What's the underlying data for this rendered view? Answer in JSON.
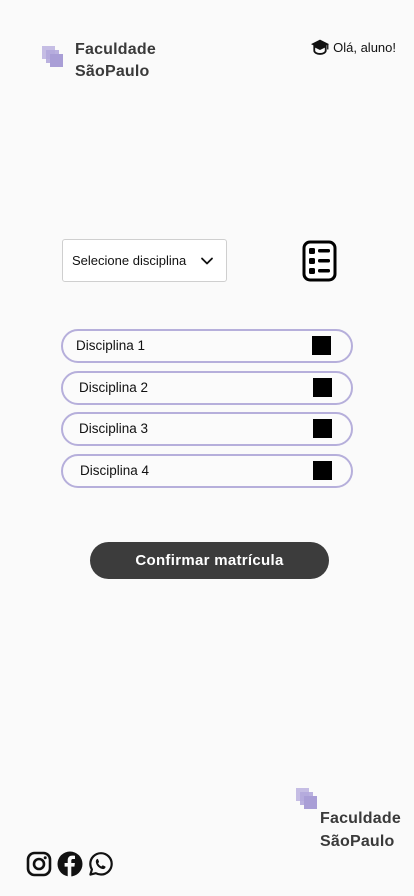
{
  "header": {
    "brand_line1": "Faculdade",
    "brand_line2": "SãoPaulo",
    "logo_icon": "stacked-squares-icon",
    "greeting_icon": "graduation-cap-icon",
    "greeting": "Olá, aluno!"
  },
  "select": {
    "label": "Selecione disciplina",
    "chevron_icon": "chevron-down-icon"
  },
  "list_view_icon": "list-icon",
  "disciplines": [
    {
      "label": "Disciplina 1"
    },
    {
      "label": "Disciplina 2"
    },
    {
      "label": "Disciplina 3"
    },
    {
      "label": "Disciplina 4"
    }
  ],
  "confirm_label": "Confirmar matrícula",
  "footer": {
    "brand_line1": "Faculdade",
    "brand_line2": "SãoPaulo",
    "social_icons": [
      "instagram-icon",
      "facebook-icon",
      "whatsapp-icon"
    ]
  },
  "colors": {
    "accent": "#b6afdb",
    "button": "#3c3c3c",
    "background": "#fafafa"
  }
}
